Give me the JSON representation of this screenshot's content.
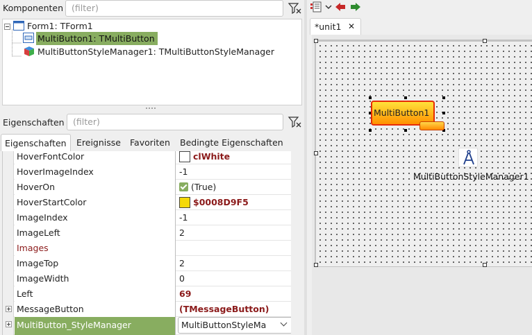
{
  "components": {
    "label": "Komponenten",
    "filter_placeholder": "(filter)",
    "tree": [
      {
        "label": "Form1: TForm1"
      },
      {
        "label": "MultiButton1: TMultiButton"
      },
      {
        "label": "MultiButtonStyleManager1: TMultiButtonStyleManager"
      }
    ]
  },
  "properties": {
    "label": "Eigenschaften",
    "filter_placeholder": "(filter)",
    "tabs": [
      "Eigenschaften",
      "Ereignisse",
      "Favoriten",
      "Bedingte Eigenschaften"
    ],
    "rows": [
      {
        "name": "HoverFontColor",
        "value": "clWhite"
      },
      {
        "name": "HoverImageIndex",
        "value": "-1"
      },
      {
        "name": "HoverOn",
        "value": "(True)"
      },
      {
        "name": "HoverStartColor",
        "value": "$0008D9F5"
      },
      {
        "name": "ImageIndex",
        "value": "-1"
      },
      {
        "name": "ImageLeft",
        "value": "2"
      },
      {
        "name": "Images",
        "value": ""
      },
      {
        "name": "ImageTop",
        "value": "2"
      },
      {
        "name": "ImageWidth",
        "value": "0"
      },
      {
        "name": "Left",
        "value": "69"
      },
      {
        "name": "MessageButton",
        "value": "(TMessageButton)"
      },
      {
        "name": "MultiButton_StyleManager",
        "value": "MultiButtonStyleMa"
      }
    ]
  },
  "colors": {
    "selection": "#88ad60",
    "modified_value": "#8b1a1a",
    "swatch_white": "#ffffff",
    "swatch_yellow": "#f5d908"
  },
  "editor": {
    "tab_label": "*unit1",
    "tab_close": "✕",
    "toolbar_icons": [
      "component-list-icon",
      "arrow-left-icon",
      "arrow-right-icon"
    ]
  },
  "designer": {
    "button_caption": "MultiButton1",
    "manager_caption": "MultiButtonStyleManager1"
  }
}
